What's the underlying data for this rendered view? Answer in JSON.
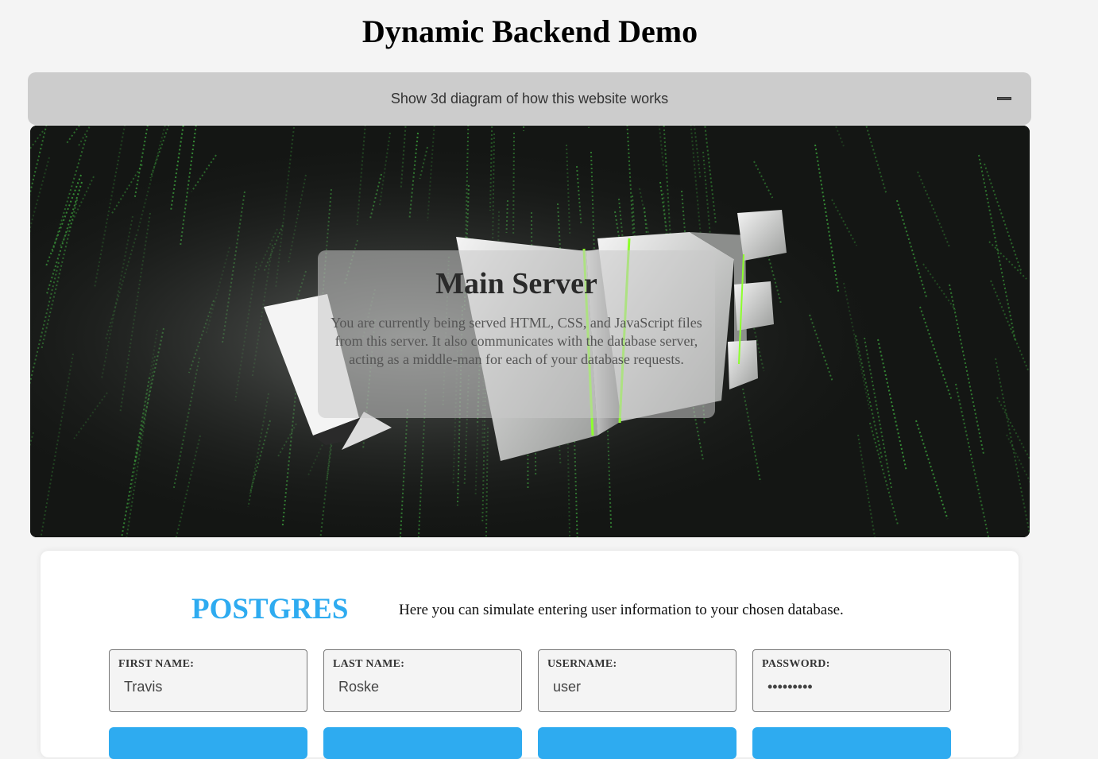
{
  "page": {
    "title": "Dynamic Backend Demo"
  },
  "accordion": {
    "label": "Show 3d diagram of how this website works",
    "toggle_icon": "minus-icon"
  },
  "diagram": {
    "panel_title": "Main Server",
    "panel_text": "You are currently being served HTML, CSS, and JavaScript files from this server. It also communicates with the database server, acting as a middle-man for each of your database requests.",
    "background_color": "#141614",
    "code_rain_color": "#3fae3f"
  },
  "form": {
    "database_name": "POSTGRES",
    "description": "Here you can simulate entering user information to your chosen database.",
    "accent_color": "#2eabf0",
    "fields": [
      {
        "label": "FIRST NAME:",
        "value": "Travis",
        "type": "text"
      },
      {
        "label": "LAST NAME:",
        "value": "Roske",
        "type": "text"
      },
      {
        "label": "USERNAME:",
        "value": "user",
        "type": "text"
      },
      {
        "label": "PASSWORD:",
        "value": "password1",
        "type": "password"
      }
    ]
  }
}
